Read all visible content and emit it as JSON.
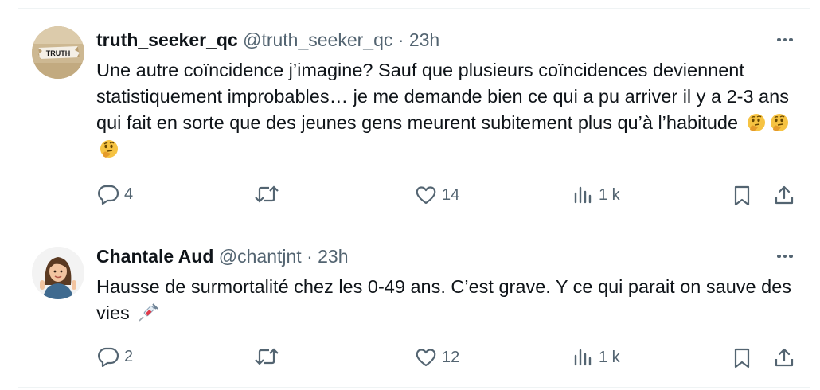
{
  "tweets": [
    {
      "name": "truth_seeker_qc",
      "handle": "@truth_seeker_qc",
      "separator": "·",
      "time": "23h",
      "avatar_text": "TRUTH",
      "text": "Une autre coïncidence j’imagine?  Sauf que plusieurs coïncidences deviennent statistiquement improbables… je me demande bien ce qui a pu arriver il y a 2-3 ans qui fait en sorte que des jeunes gens meurent subitement plus qu’à l’habitude",
      "emojis": [
        "thinking-face-icon",
        "thinking-face-icon",
        "thinking-face-icon"
      ],
      "replies": "4",
      "reposts": "",
      "likes": "14",
      "views": "1 k"
    },
    {
      "name": "Chantale Aud",
      "handle": "@chantjnt",
      "separator": "·",
      "time": "23h",
      "text": "Hausse de surmortalité chez les 0-49 ans.  C’est grave.  Y ce qui parait on sauve des vies",
      "emojis": [
        "syringe-icon"
      ],
      "replies": "2",
      "reposts": "",
      "likes": "12",
      "views": "1 k"
    }
  ],
  "colors": {
    "text": "#0f1419",
    "secondary": "#536471",
    "divider": "#eff3f4",
    "background": "#ffffff"
  }
}
